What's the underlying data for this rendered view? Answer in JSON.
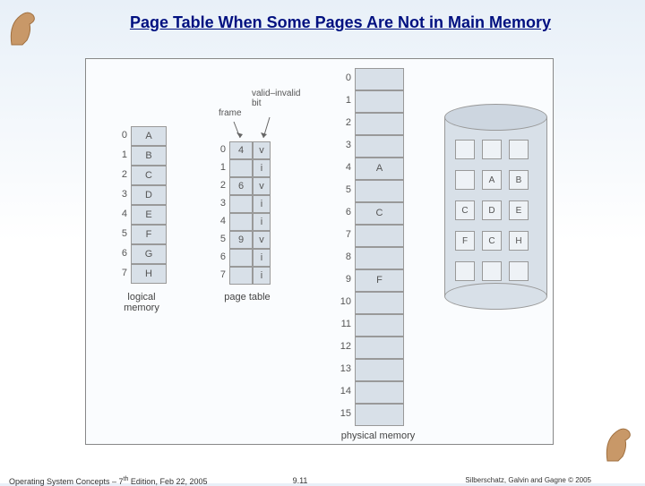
{
  "title": "Page Table When Some Pages Are Not in Main Memory",
  "footer": {
    "left_a": "Operating System Concepts – 7",
    "left_sup": "th",
    "left_b": " Edition, Feb 22, 2005",
    "center": "9.11",
    "right": "Silberschatz, Galvin and Gagne © 2005"
  },
  "labels": {
    "logical": "logical\nmemory",
    "page_table": "page table",
    "physical": "physical memory",
    "frame": "frame",
    "valid": "valid–invalid\nbit"
  },
  "logical_memory": {
    "indices": [
      "0",
      "1",
      "2",
      "3",
      "4",
      "5",
      "6",
      "7"
    ],
    "pages": [
      "A",
      "B",
      "C",
      "D",
      "E",
      "F",
      "G",
      "H"
    ]
  },
  "page_table": {
    "indices": [
      "0",
      "1",
      "2",
      "3",
      "4",
      "5",
      "6",
      "7"
    ],
    "frame": [
      "4",
      "",
      "6",
      "",
      "",
      "9",
      "",
      ""
    ],
    "valid": [
      "v",
      "i",
      "v",
      "i",
      "i",
      "v",
      "i",
      "i"
    ]
  },
  "physical_memory": {
    "indices": [
      "0",
      "1",
      "2",
      "3",
      "4",
      "5",
      "6",
      "7",
      "8",
      "9",
      "10",
      "11",
      "12",
      "13",
      "14",
      "15"
    ],
    "contents": {
      "4": "A",
      "6": "C",
      "9": "F"
    }
  },
  "disk": {
    "rows": [
      [
        "",
        "",
        ""
      ],
      [
        "",
        "A",
        "B"
      ],
      [
        "C",
        "D",
        "E"
      ],
      [
        "F",
        "C",
        "H"
      ],
      [
        "",
        "",
        ""
      ]
    ]
  }
}
